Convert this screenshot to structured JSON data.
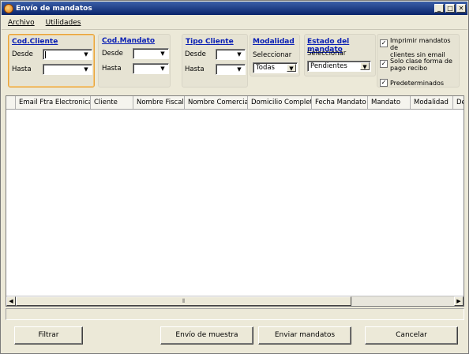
{
  "window": {
    "title": "Envío de mandatos",
    "buttons": {
      "minimize": "_",
      "maximize": "□",
      "close": "✕"
    }
  },
  "menu": [
    {
      "label": "Archivo"
    },
    {
      "label": "Utilidades"
    }
  ],
  "filters": {
    "cod_cliente": {
      "title": "Cod.Cliente",
      "desde_label": "Desde",
      "hasta_label": "Hasta",
      "desde_value": "",
      "hasta_value": ""
    },
    "cod_mandato": {
      "title": "Cod.Mandato",
      "desde_label": "Desde",
      "hasta_label": "Hasta",
      "desde_value": "",
      "hasta_value": ""
    },
    "tipo_cliente": {
      "title": "Tipo Cliente",
      "desde_label": "Desde",
      "hasta_label": "Hasta",
      "desde_value": "",
      "hasta_value": ""
    },
    "modalidad": {
      "title": "Modalidad",
      "sub_label": "Seleccionar",
      "value": "Todas"
    },
    "estado_mandato": {
      "title": "Estado del mandato",
      "sub_label": "Seleccionar",
      "value": "Pendientes"
    }
  },
  "options": [
    {
      "label_line1": "Imprimir mandatos de",
      "label_line2": "clientes sin email",
      "checked": true
    },
    {
      "label_line1": "Solo clase forma de",
      "label_line2": "pago recibo",
      "checked": true
    },
    {
      "label_line1": "Predeterminados",
      "label_line2": "",
      "checked": true
    }
  ],
  "grid": {
    "columns": [
      "Email Ftra Electronica",
      "Cliente",
      "Nombre Fiscal",
      "Nombre Comercial",
      "Domicilio Completo",
      "Fecha Mandato",
      "Mandato",
      "Modalidad",
      "De"
    ]
  },
  "buttons": {
    "filtrar": "Filtrar",
    "envio_muestra": "Envío de muestra",
    "enviar_mandatos": "Enviar mandatos",
    "cancelar": "Cancelar"
  }
}
